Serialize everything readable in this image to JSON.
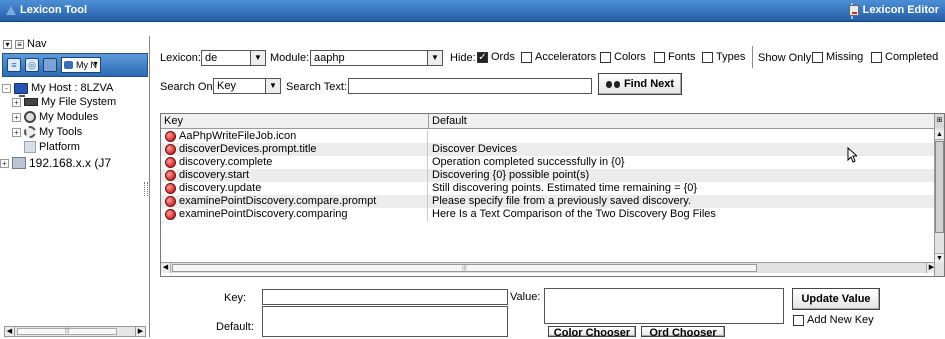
{
  "window": {
    "title": "Lexicon Tool",
    "editor_label": "Lexicon Editor"
  },
  "nav": {
    "header": "Nav",
    "toolbar_select": "My N",
    "tree": [
      {
        "label": "My Host : 8LZVA",
        "expander": "-"
      },
      {
        "label": "My File System",
        "expander": "+"
      },
      {
        "label": "My Modules",
        "expander": "+"
      },
      {
        "label": "My Tools",
        "expander": "+"
      },
      {
        "label": "Platform",
        "expander": ""
      },
      {
        "label": "192.168.x.x (J7",
        "expander": "+"
      }
    ]
  },
  "controls": {
    "lexicon_label": "Lexicon:",
    "lexicon_value": "de",
    "module_label": "Module:",
    "module_value": "aaphp",
    "hide_label": "Hide:",
    "hide_options": [
      {
        "label": "Ords",
        "checked": true
      },
      {
        "label": "Accelerators",
        "checked": false
      },
      {
        "label": "Colors",
        "checked": false
      },
      {
        "label": "Fonts",
        "checked": false
      },
      {
        "label": "Types",
        "checked": false
      }
    ],
    "show_only_label": "Show Only:",
    "show_only_options": [
      {
        "label": "Missing",
        "checked": false
      },
      {
        "label": "Completed",
        "checked": false
      }
    ],
    "search_on_label": "Search On:",
    "search_on_value": "Key",
    "search_text_label": "Search Text:",
    "search_text_value": "",
    "find_next_label": "Find Next"
  },
  "table": {
    "columns": [
      "Key",
      "Default"
    ],
    "rows": [
      {
        "key": "AaPhpWriteFileJob.icon",
        "default": ""
      },
      {
        "key": "discoverDevices.prompt.title",
        "default": "Discover Devices"
      },
      {
        "key": "discovery.complete",
        "default": "Operation completed successfully in {0}"
      },
      {
        "key": "discovery.start",
        "default": "Discovering {0} possible point(s)"
      },
      {
        "key": "discovery.update",
        "default": "Still discovering points. Estimated time remaining = {0}"
      },
      {
        "key": "examinePointDiscovery.compare.prompt",
        "default": "Please specify file from a previously saved discovery."
      },
      {
        "key": "examinePointDiscovery.comparing",
        "default": "Here Is a Text Comparison of the Two Discovery Bog Files"
      }
    ]
  },
  "editor": {
    "key_label": "Key:",
    "key_value": "",
    "value_label": "Value:",
    "default_label": "Default:",
    "update_button": "Update Value",
    "add_new_key_label": "Add New Key",
    "color_chooser_button": "Color Chooser",
    "ord_chooser_button": "Ord Chooser"
  }
}
